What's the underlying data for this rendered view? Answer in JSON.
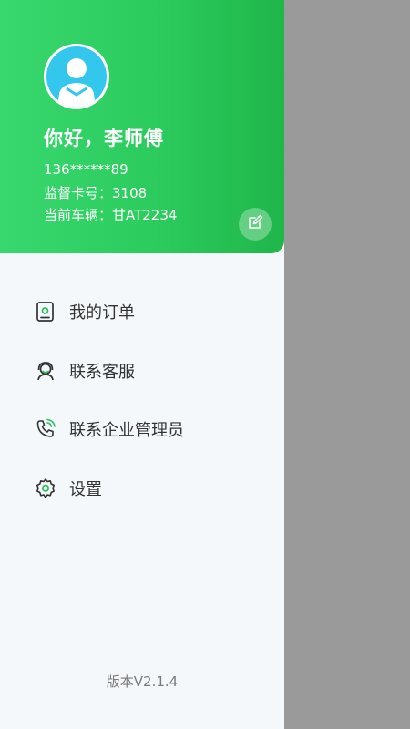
{
  "profile": {
    "greeting": "你好，李师傅",
    "phone": "136******89",
    "card_number": "监督卡号：3108",
    "current_vehicle": "当前车辆：甘AT2234"
  },
  "menu": {
    "orders_label": "我的订单",
    "support_label": "联系客服",
    "admin_label": "联系企业管理员",
    "settings_label": "设置"
  },
  "footer": {
    "version": "版本V2.1.4"
  },
  "colors": {
    "header_gradient_start": "#38d86f",
    "header_gradient_end": "#1fb64a",
    "avatar_bg": "#34c7ee",
    "icon_accent": "#2bc05a",
    "overlay": "#9a9a9a",
    "drawer_bg": "#f4f8fb"
  },
  "icons": {
    "avatar": "user-avatar-icon",
    "edit": "edit-icon",
    "orders": "order-list-icon",
    "support": "customer-service-icon",
    "admin": "phone-call-icon",
    "settings": "gear-icon"
  }
}
